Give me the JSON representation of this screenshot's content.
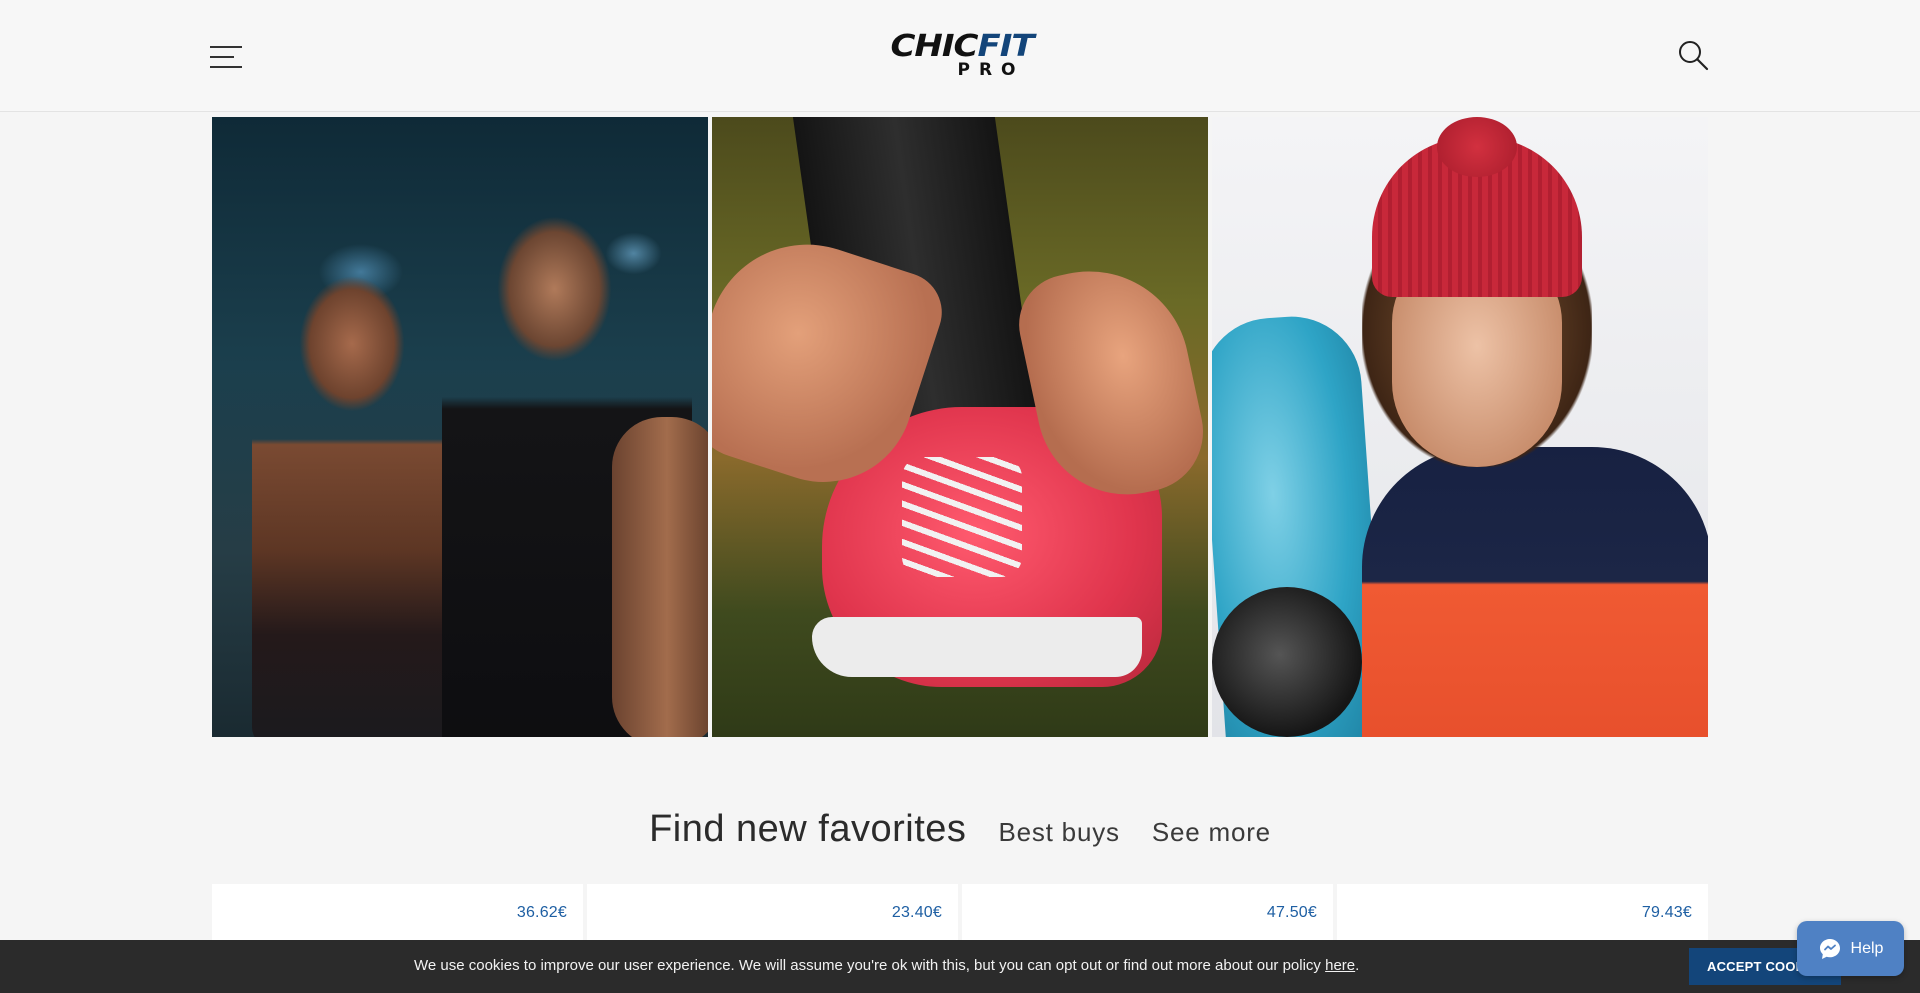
{
  "header": {
    "logo": {
      "main_dark": "CHIC",
      "main_accent": "FIT",
      "sub": "PRO"
    },
    "menu_icon": "hamburger-menu-icon",
    "search_icon": "search-icon"
  },
  "hero": {
    "tiles": [
      {
        "name": "gym-couple-photo"
      },
      {
        "name": "running-shoe-photo"
      },
      {
        "name": "snowboarder-photo"
      }
    ]
  },
  "section": {
    "title": "Find new favorites",
    "tabs": [
      "Best buys",
      "See more"
    ]
  },
  "products": [
    {
      "price": "36.62€"
    },
    {
      "price": "23.40€"
    },
    {
      "price": "47.50€"
    },
    {
      "price": "79.43€"
    }
  ],
  "cookie": {
    "text": "We use cookies to improve our user experience. We will assume you're ok with this, but you can opt out or find out more about our policy ",
    "link": "here",
    "after": ".",
    "button": "ACCEPT COOKIES"
  },
  "help": {
    "label": "Help",
    "icon": "chat-bubble-icon"
  },
  "colors": {
    "brand_blue": "#13457a",
    "price_blue": "#1e5fa3",
    "help_blue": "#4f81c4",
    "cookie_bg": "#2b2b2b"
  }
}
